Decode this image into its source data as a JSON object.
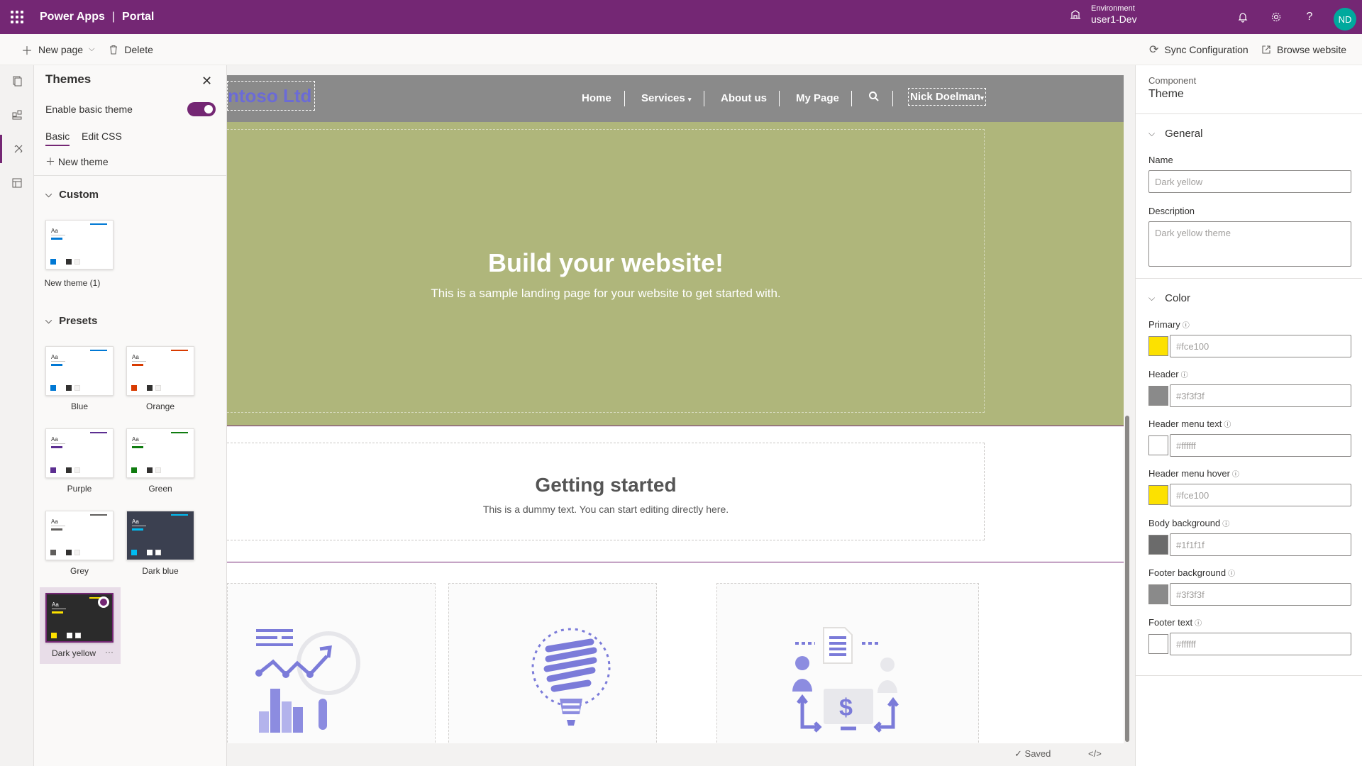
{
  "topbar": {
    "app_name": "Power Apps",
    "separator": "|",
    "portal_name": "Portal",
    "environment_label": "Environment",
    "environment_value": "user1-Dev",
    "avatar_initials": "ND"
  },
  "commands": {
    "new_page": "New page",
    "delete": "Delete",
    "sync": "Sync Configuration",
    "browse": "Browse website"
  },
  "themes_panel": {
    "title": "Themes",
    "enable_label": "Enable basic theme",
    "enable_on": true,
    "tabs": [
      "Basic",
      "Edit CSS"
    ],
    "new_theme": "New theme",
    "custom_header": "Custom",
    "custom_themes": [
      {
        "label": "New theme (1)",
        "accent": "#0078d4"
      }
    ],
    "presets_header": "Presets",
    "presets": [
      {
        "label": "Blue",
        "accent": "#0078d4"
      },
      {
        "label": "Orange",
        "accent": "#d83b01"
      },
      {
        "label": "Purple",
        "accent": "#5c2e91"
      },
      {
        "label": "Green",
        "accent": "#107c10"
      },
      {
        "label": "Grey",
        "accent": "#605e5c"
      },
      {
        "label": "Dark blue",
        "accent": "#00bcf2"
      },
      {
        "label": "Dark yellow",
        "accent": "#fce100",
        "selected": true
      }
    ]
  },
  "site": {
    "logo_text": "ntoso Ltd",
    "nav": [
      "Home",
      "Services",
      "About us",
      "My Page"
    ],
    "user": "Nick Doelman",
    "hero_title": "Build your website!",
    "hero_sub": "This is a sample landing page for your website to get started with.",
    "gs_title": "Getting started",
    "gs_text": "This is a dummy text. You can start editing directly here."
  },
  "status": {
    "saved": "Saved",
    "code": "</>"
  },
  "right_panel": {
    "component_label": "Component",
    "component_value": "Theme",
    "general_header": "General",
    "name_label": "Name",
    "name_value": "Dark yellow",
    "description_label": "Description",
    "description_value": "Dark yellow theme",
    "color_header": "Color",
    "colors": [
      {
        "label": "Primary",
        "value": "#fce100"
      },
      {
        "label": "Header",
        "value": "#3f3f3f"
      },
      {
        "label": "Header menu text",
        "value": "#ffffff"
      },
      {
        "label": "Header menu hover",
        "value": "#fce100"
      },
      {
        "label": "Body background",
        "value": "#1f1f1f"
      },
      {
        "label": "Footer background",
        "value": "#3f3f3f"
      },
      {
        "label": "Footer text",
        "value": "#ffffff"
      }
    ]
  },
  "colors": {
    "brand": "#742774",
    "hero_bg": "#afb67b",
    "nav_bg": "#8a8a8a"
  }
}
